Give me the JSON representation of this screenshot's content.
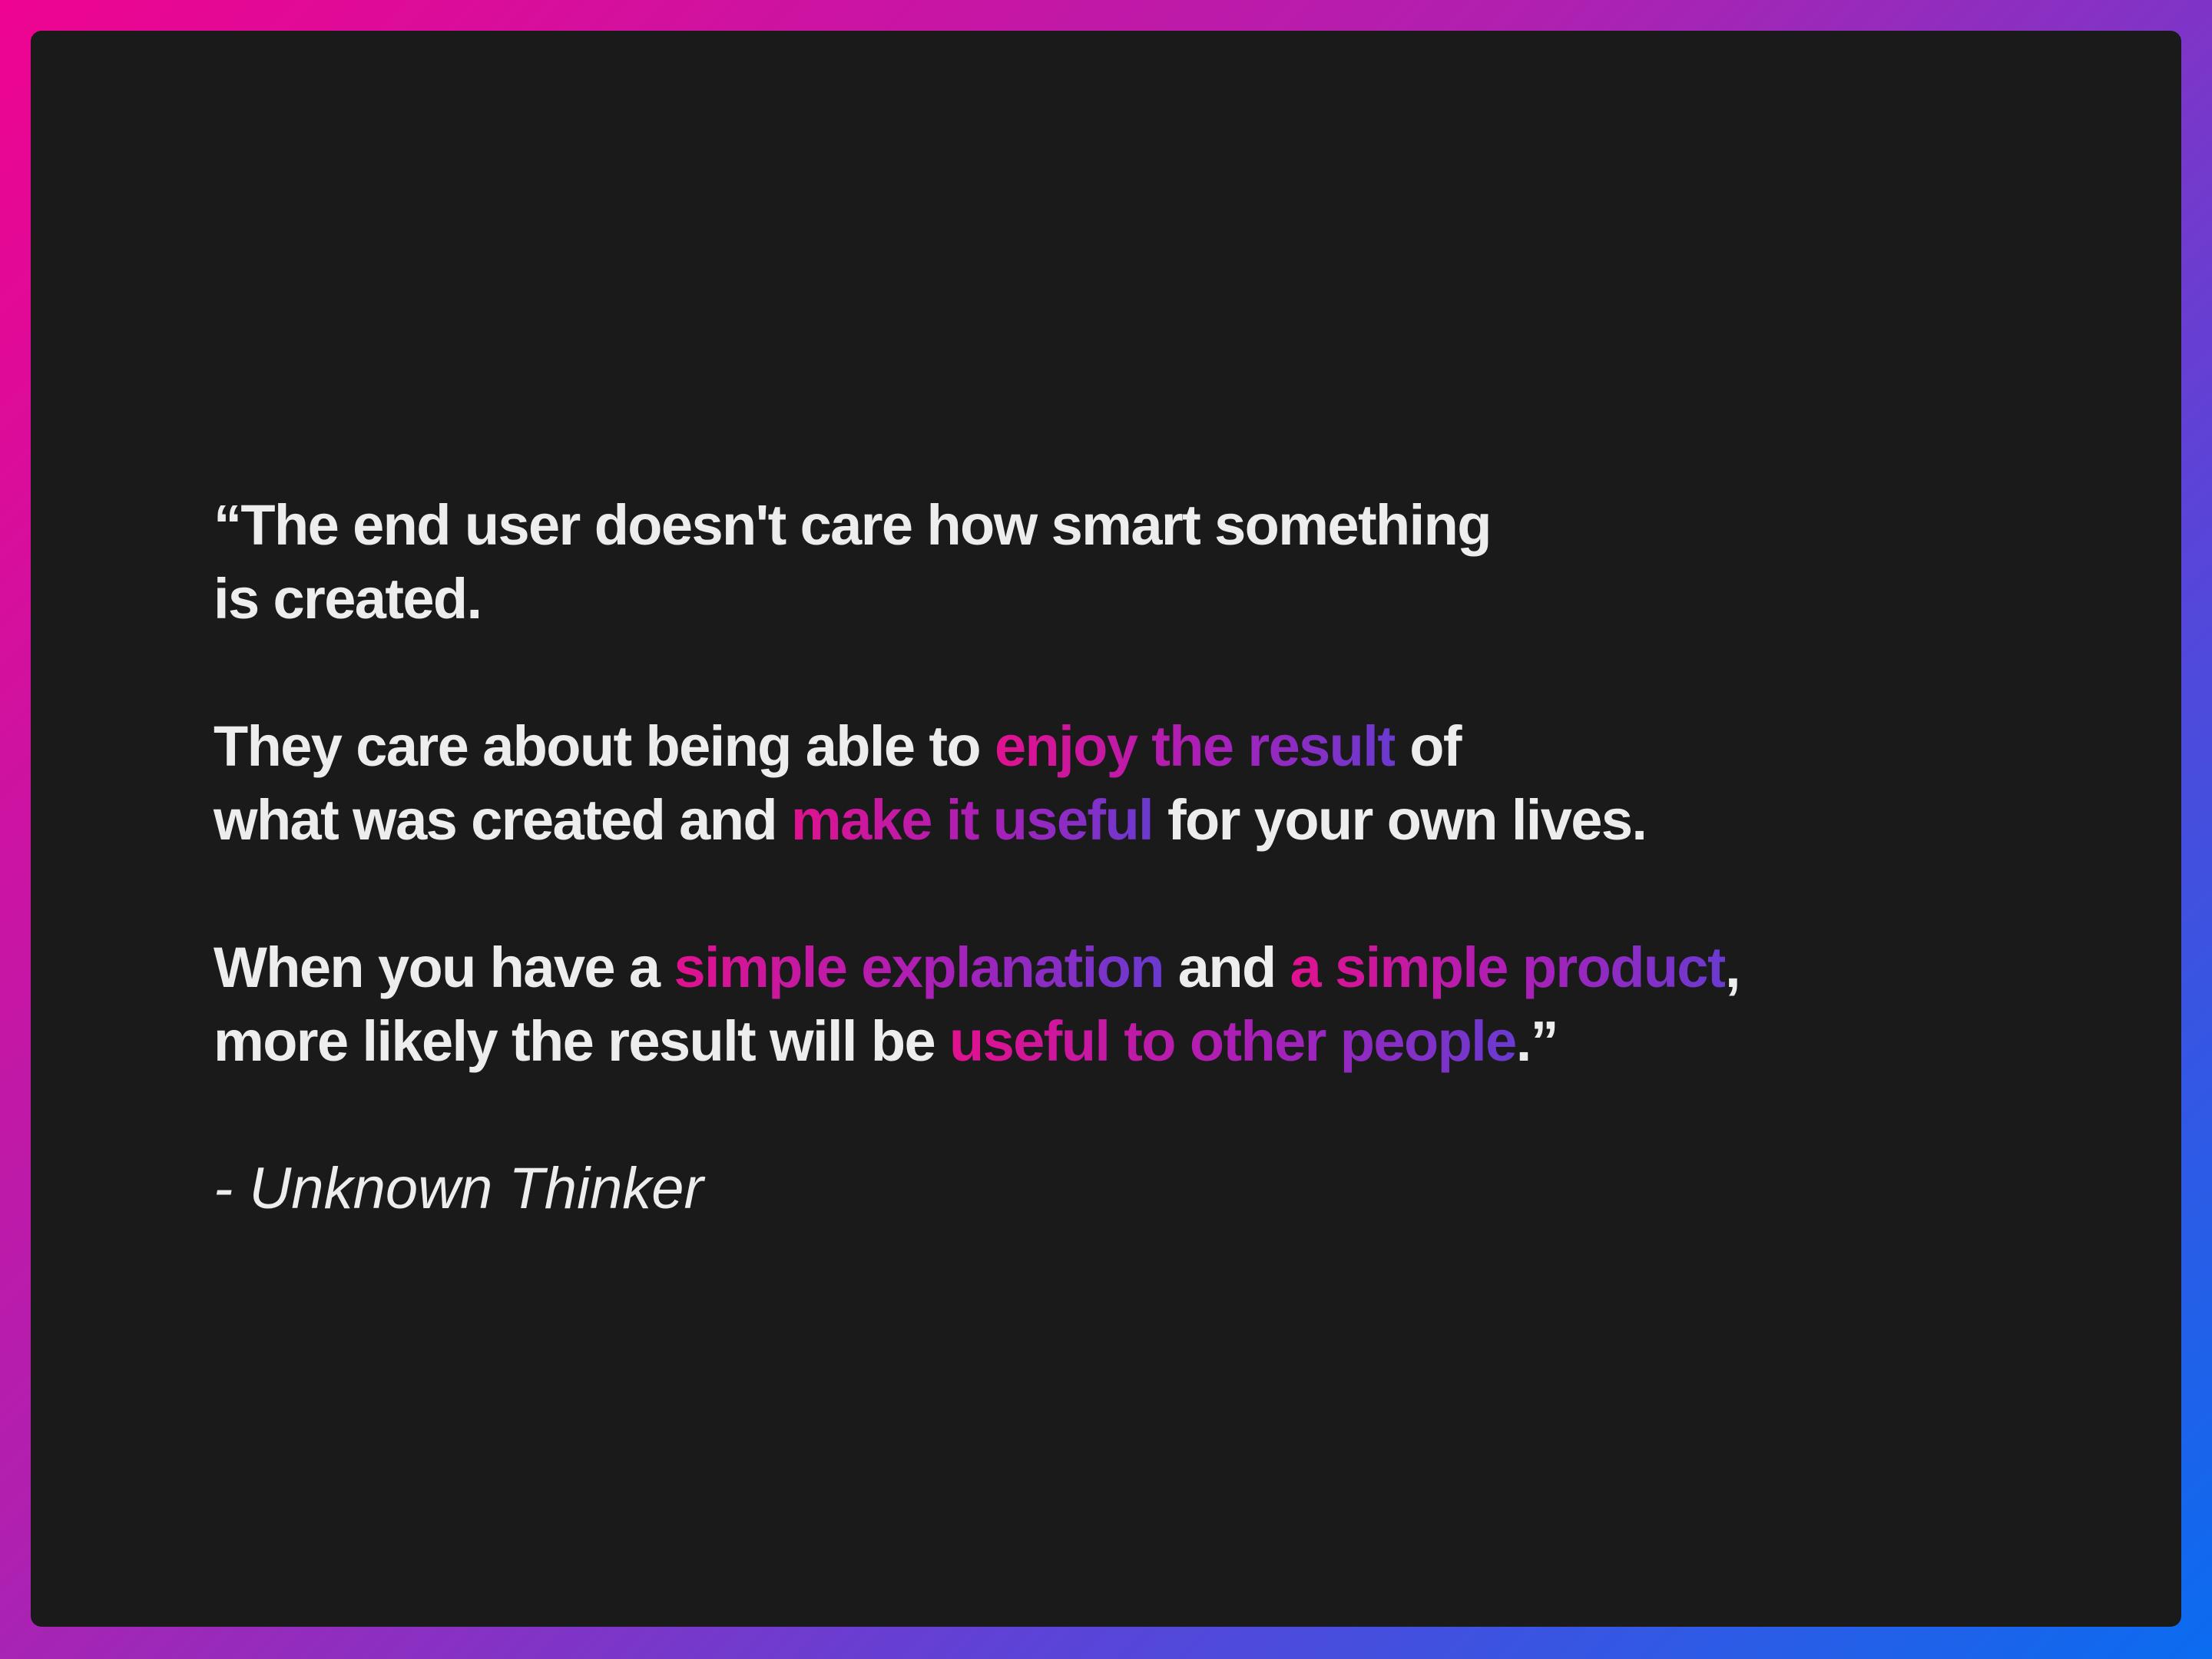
{
  "quote": {
    "p1": {
      "line1": "“The end user doesn't care how smart something",
      "line2": "is created."
    },
    "p2": {
      "a": "They care about being able to ",
      "hl1": "enjoy the result",
      "b": " of",
      "c": "what was created and ",
      "hl2": "make it useful",
      "d": " for your own lives."
    },
    "p3": {
      "a": "When you have a ",
      "hl1": "simple explanation",
      "b": " and ",
      "hl2": "a simple product",
      "c": ",",
      "d": "more likely the result will be ",
      "hl3": "useful to other people",
      "e": ".”"
    }
  },
  "attribution": "- Unknown Thinker",
  "colors": {
    "panel_bg": "#1a1a1a",
    "text": "#ededed",
    "gradient_start": "#ee0490",
    "gradient_end": "#0a6cf0",
    "highlight_start": "#e0128e",
    "highlight_end": "#6a3ad0"
  }
}
